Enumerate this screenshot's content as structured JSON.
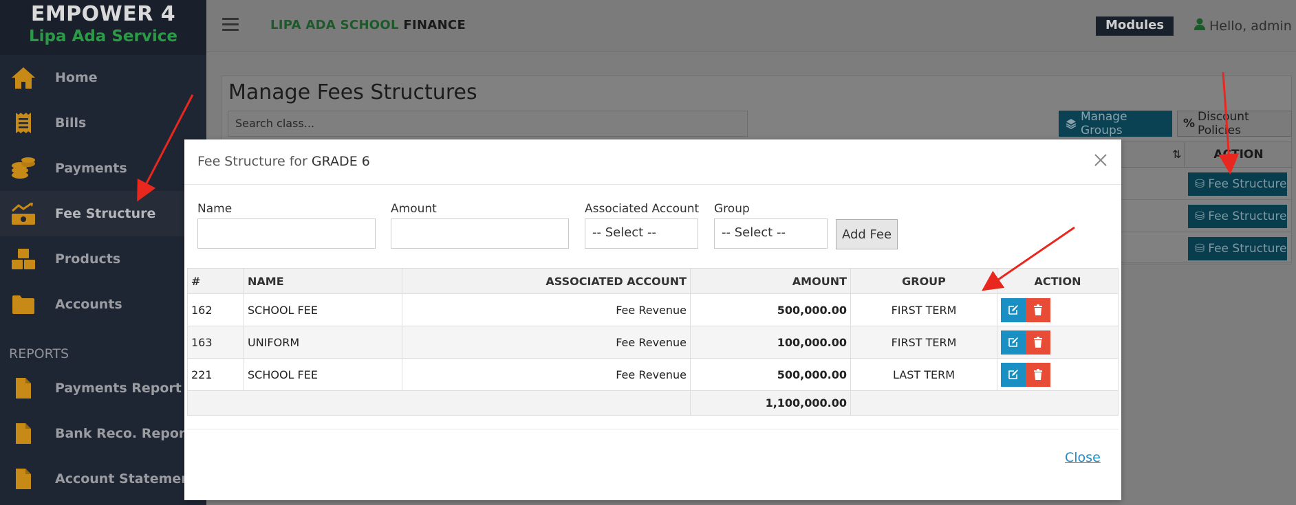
{
  "brand": {
    "title": "EMPOWER 4",
    "subtitle": "Lipa Ada Service"
  },
  "sidebar": {
    "items": [
      {
        "label": "Home",
        "icon": "home-icon"
      },
      {
        "label": "Bills",
        "icon": "receipt-icon"
      },
      {
        "label": "Payments",
        "icon": "coins-icon"
      },
      {
        "label": "Fee Structure",
        "icon": "chart-money-icon",
        "active": true
      },
      {
        "label": "Products",
        "icon": "boxes-icon"
      },
      {
        "label": "Accounts",
        "icon": "folder-icon"
      }
    ],
    "reports_label": "REPORTS",
    "reports": [
      {
        "label": "Payments Report",
        "icon": "file-icon"
      },
      {
        "label": "Bank Reco. Report",
        "icon": "file-icon"
      },
      {
        "label": "Account Statement",
        "icon": "file-icon"
      }
    ]
  },
  "header": {
    "app_name_part1": "LIPA ADA SCHOOL",
    "app_name_part2": "FINANCE",
    "modules_label": "Modules",
    "greeting": "Hello, admin"
  },
  "page": {
    "title": "Manage Fees Structures",
    "search_placeholder": "Search class...",
    "manage_groups_label": "Manage Groups",
    "discount_policies_label": "Discount Policies",
    "action_header": "ACTION",
    "row_button_label": "Fee Structure"
  },
  "modal": {
    "title_prefix": "Fee Structure for",
    "title_class": "GRADE 6",
    "form": {
      "name_label": "Name",
      "amount_label": "Amount",
      "account_label": "Associated Account",
      "account_value": "-- Select --",
      "group_label": "Group",
      "group_value": "-- Select --",
      "add_button": "Add Fee"
    },
    "table": {
      "headers": [
        "#",
        "NAME",
        "ASSOCIATED ACCOUNT",
        "AMOUNT",
        "GROUP",
        "ACTION"
      ],
      "rows": [
        {
          "id": "162",
          "name": "SCHOOL FEE",
          "account": "Fee Revenue",
          "amount": "500,000.00",
          "group": "FIRST TERM"
        },
        {
          "id": "163",
          "name": "UNIFORM",
          "account": "Fee Revenue",
          "amount": "100,000.00",
          "group": "FIRST TERM"
        },
        {
          "id": "221",
          "name": "SCHOOL FEE",
          "account": "Fee Revenue",
          "amount": "500,000.00",
          "group": "LAST TERM"
        }
      ],
      "total": "1,100,000.00"
    },
    "close_label": "Close"
  },
  "colors": {
    "accent_green": "#2a9a46",
    "edit_blue": "#1a8fc4",
    "delete_red": "#e84b36",
    "annotation_red": "#e8281e"
  }
}
